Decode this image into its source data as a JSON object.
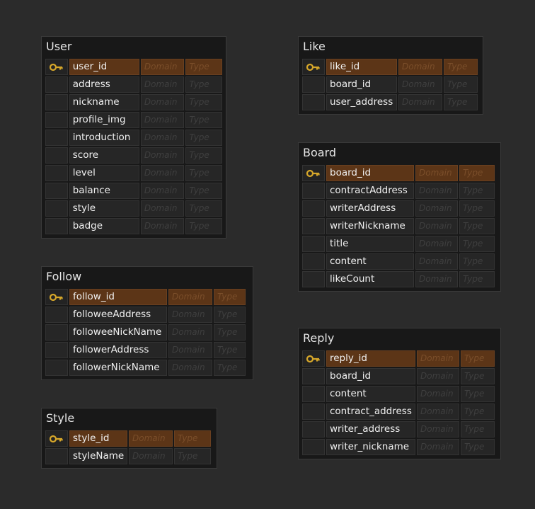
{
  "placeholders": {
    "domain": "Domain",
    "type": "Type"
  },
  "colors": {
    "primary_key_row": "#5c3517",
    "key_icon": "#d6a72a",
    "background": "#2b2b2b"
  },
  "entities": {
    "user": {
      "name": "User",
      "columns": [
        {
          "name": "user_id",
          "pk": true
        },
        {
          "name": "address"
        },
        {
          "name": "nickname"
        },
        {
          "name": "profile_img"
        },
        {
          "name": "introduction"
        },
        {
          "name": "score"
        },
        {
          "name": "level"
        },
        {
          "name": "balance"
        },
        {
          "name": "style"
        },
        {
          "name": "badge"
        }
      ]
    },
    "follow": {
      "name": "Follow",
      "columns": [
        {
          "name": "follow_id",
          "pk": true
        },
        {
          "name": "followeeAddress"
        },
        {
          "name": "followeeNickName"
        },
        {
          "name": "followerAddress"
        },
        {
          "name": "followerNickName"
        }
      ]
    },
    "style": {
      "name": "Style",
      "columns": [
        {
          "name": "style_id",
          "pk": true
        },
        {
          "name": "styleName"
        }
      ]
    },
    "like": {
      "name": "Like",
      "columns": [
        {
          "name": "like_id",
          "pk": true
        },
        {
          "name": "board_id"
        },
        {
          "name": "user_address"
        }
      ]
    },
    "board": {
      "name": "Board",
      "columns": [
        {
          "name": "board_id",
          "pk": true
        },
        {
          "name": "contractAddress"
        },
        {
          "name": "writerAddress"
        },
        {
          "name": "writerNickname"
        },
        {
          "name": "title"
        },
        {
          "name": "content"
        },
        {
          "name": "likeCount"
        }
      ]
    },
    "reply": {
      "name": "Reply",
      "columns": [
        {
          "name": "reply_id",
          "pk": true
        },
        {
          "name": "board_id"
        },
        {
          "name": "content"
        },
        {
          "name": "contract_address"
        },
        {
          "name": "writer_address"
        },
        {
          "name": "writer_nickname"
        }
      ]
    }
  }
}
